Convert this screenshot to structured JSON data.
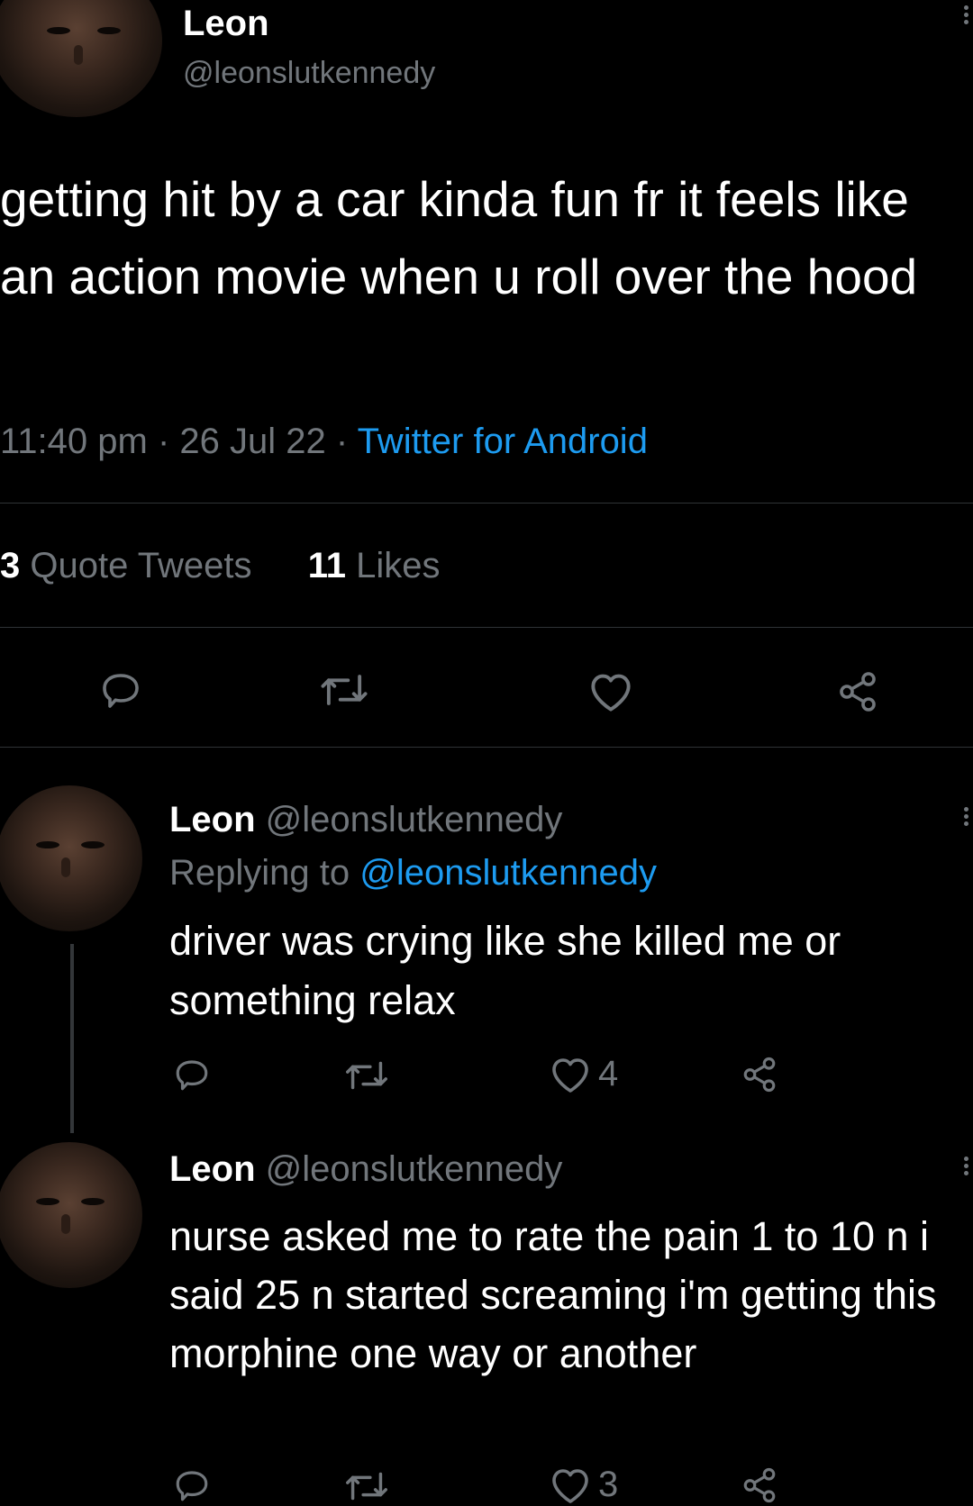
{
  "main_tweet": {
    "name": "Leon",
    "handle": "@leonslutkennedy",
    "text": "getting hit by a car kinda fun fr it feels like an action movie when u roll over the hood",
    "time": "11:40 pm",
    "sep1": "·",
    "date": "26 Jul 22",
    "sep2": "·",
    "source": "Twitter for Android",
    "quote_count": "3",
    "quote_label": "Quote Tweets",
    "like_count": "11",
    "like_label": "Likes"
  },
  "replies": [
    {
      "name": "Leon",
      "handle": "@leonslutkennedy",
      "replying_prefix": "Replying to",
      "replying_handle": "@leonslutkennedy",
      "text": "driver was crying like she killed me or something relax",
      "likes": "4"
    },
    {
      "name": "Leon",
      "handle": "@leonslutkennedy",
      "text": "nurse asked me to rate the pain 1 to 10 n i said 25 n started screaming i'm getting this morphine one way or another",
      "likes": "3"
    }
  ],
  "colors": {
    "background": "#000000",
    "text": "#e7e9ea",
    "muted": "#71767b",
    "accent": "#1d9bf0",
    "divider": "#2f3336"
  },
  "icons": [
    "reply-icon",
    "retweet-icon",
    "like-icon",
    "share-icon",
    "more-icon"
  ]
}
